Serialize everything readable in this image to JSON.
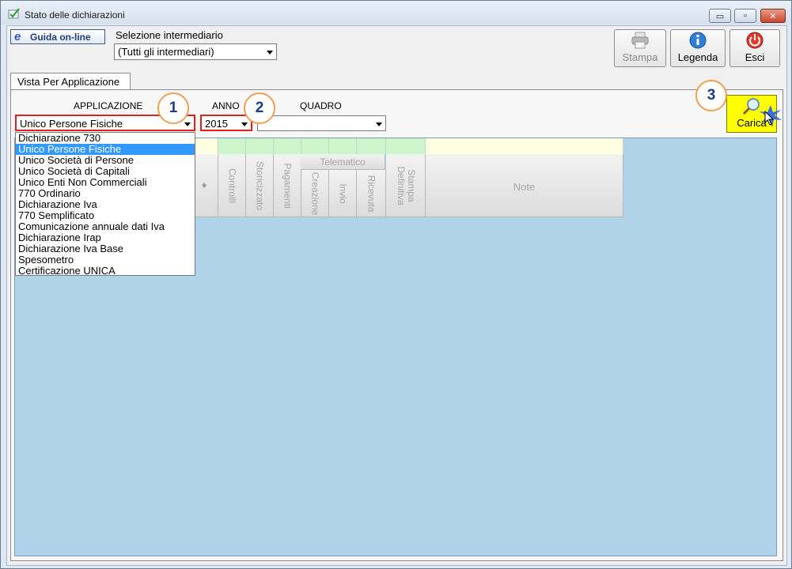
{
  "window": {
    "title": "Stato delle dichiarazioni",
    "min_glyph": "▭",
    "max_glyph": "▫",
    "close_glyph": "✕"
  },
  "toolbar": {
    "help_label": "Guida on-line",
    "intermediary_label": "Selezione intermediario",
    "intermediary_value": "(Tutti gli intermediari)",
    "print_label": "Stampa",
    "legend_label": "Legenda",
    "exit_label": "Esci"
  },
  "tab": {
    "label": "Vista Per Applicazione"
  },
  "filters": {
    "application_label": "APPLICAZIONE",
    "application_value": "Unico Persone Fisiche",
    "year_label": "ANNO",
    "year_value": "2015",
    "section_label": "QUADRO",
    "section_value": "",
    "load_label": "Carica"
  },
  "dropdown": {
    "items": [
      "Dichiarazione 730",
      "Unico Persone Fisiche",
      "Unico Società di Persone",
      "Unico Società di Capitali",
      "Unico Enti Non Commerciali",
      "770 Ordinario",
      "Dichiarazione Iva",
      "770 Semplificato",
      "Comunicazione annuale dati Iva",
      "Dichiarazione Irap",
      "Dichiarazione Iva Base",
      "Spesometro",
      "Certificazione UNICA"
    ],
    "selected_index": 1
  },
  "grid": {
    "sort_glyph": "♦",
    "columns": {
      "controlli": "Controlli",
      "storicizzato": "Storicizzato",
      "pagamenti": "Pagamenti",
      "telematico": "Telematico",
      "creazione": "Creazione",
      "invio": "Invio",
      "ricevuta": "Ricevuta",
      "stampa_definitiva": "Stampa Definitiva",
      "note": "Note"
    }
  },
  "annotations": {
    "badge1": "1",
    "badge2": "2",
    "badge3": "3"
  },
  "colors": {
    "grid_bg": "#b0d3ea",
    "strip_green": "#ccf5cc",
    "strip_yellow": "#fcffe0",
    "highlight_red": "#e02020",
    "badge_border": "#f0a050",
    "load_button": "#ffff00",
    "selection": "#3399ff"
  }
}
